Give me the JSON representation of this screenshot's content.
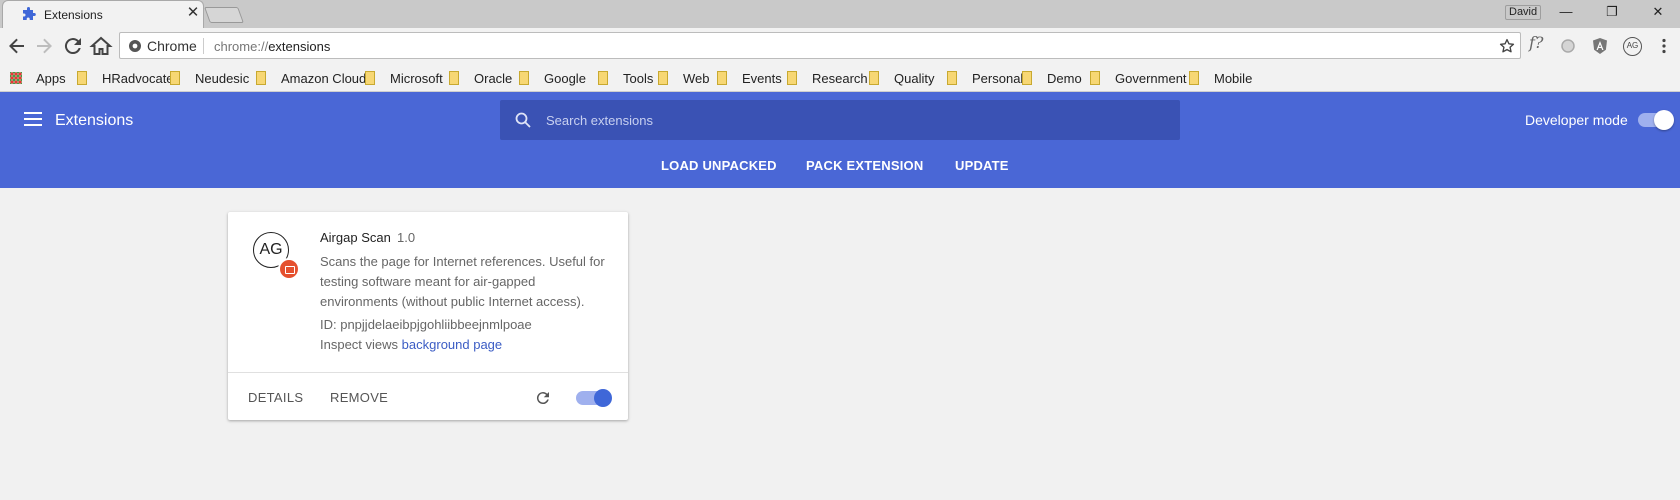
{
  "browser": {
    "tab_title": "Extensions",
    "tab_close": "✕",
    "user_name": "David",
    "window": {
      "minimize": "—",
      "restore": "❐",
      "close": "✕"
    },
    "omnibox": {
      "chip_label": "Chrome",
      "url_scheme": "chrome://",
      "url_path": "extensions"
    },
    "toolbar_icons": [
      "back-icon",
      "forward-icon",
      "reload-icon",
      "home-icon",
      "star-icon",
      "function-icon",
      "circle-extension-icon",
      "angular-extension-icon",
      "airgap-extension-icon",
      "menu-kebab-icon"
    ],
    "function_ext_label": "f?",
    "airgap_ext_label": "AG"
  },
  "bookmarks": [
    {
      "label": "Apps",
      "type": "apps"
    },
    {
      "label": "HRadvocate",
      "type": "folder"
    },
    {
      "label": "Neudesic",
      "type": "folder"
    },
    {
      "label": "Amazon Cloud",
      "type": "folder"
    },
    {
      "label": "Microsoft",
      "type": "folder"
    },
    {
      "label": "Oracle",
      "type": "folder"
    },
    {
      "label": "Google",
      "type": "folder"
    },
    {
      "label": "Tools",
      "type": "folder"
    },
    {
      "label": "Web",
      "type": "folder"
    },
    {
      "label": "Events",
      "type": "folder"
    },
    {
      "label": "Research",
      "type": "folder"
    },
    {
      "label": "Quality",
      "type": "folder"
    },
    {
      "label": "Personal",
      "type": "folder"
    },
    {
      "label": "Demo",
      "type": "folder"
    },
    {
      "label": "Government",
      "type": "folder"
    },
    {
      "label": "Mobile",
      "type": "folder"
    }
  ],
  "header": {
    "title": "Extensions",
    "search_placeholder": "Search extensions",
    "developer_mode_label": "Developer mode",
    "developer_mode_on": true,
    "actions": {
      "load_unpacked": "LOAD UNPACKED",
      "pack_extension": "PACK EXTENSION",
      "update": "UPDATE"
    },
    "accent_color": "#4a67d6"
  },
  "extension": {
    "logo_text": "AG",
    "name": "Airgap Scan",
    "version": "1.0",
    "description": "Scans the page for Internet references. Useful for testing software meant for air-gapped environments (without public Internet access).",
    "id_text": "ID: pnpjjdelaeibpjgohliibbeejnmlpoae",
    "inspect_label": "Inspect views",
    "inspect_link": "background page",
    "details_label": "DETAILS",
    "remove_label": "REMOVE",
    "enabled": true
  }
}
